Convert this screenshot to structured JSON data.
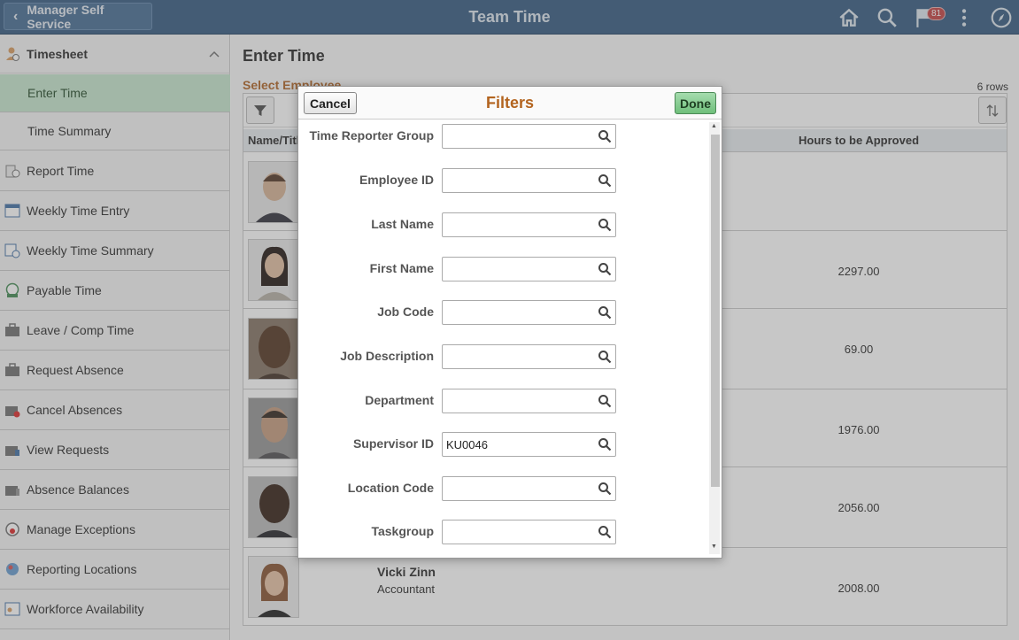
{
  "header": {
    "back_label": "Manager Self Service",
    "title": "Team Time",
    "notification_count": "81"
  },
  "sidebar": {
    "group": "Timesheet",
    "subitems": [
      "Enter Time",
      "Time Summary"
    ],
    "items": [
      "Report Time",
      "Weekly Time Entry",
      "Weekly Time Summary",
      "Payable Time",
      "Leave / Comp Time",
      "Request Absence",
      "Cancel Absences",
      "View Requests",
      "Absence Balances",
      "Manage Exceptions",
      "Reporting Locations",
      "Workforce Availability"
    ]
  },
  "main": {
    "title": "Enter Time",
    "section": "Select Employee",
    "row_count": "6 rows",
    "columns": {
      "name": "Name/Title",
      "hours": "Hours to be Approved"
    },
    "rows": [
      {
        "hours": "",
        "name": "",
        "title": ""
      },
      {
        "hours": "2297.00",
        "name": "",
        "title": ""
      },
      {
        "hours": "69.00",
        "name": "",
        "title": ""
      },
      {
        "hours": "1976.00",
        "name": "",
        "title": ""
      },
      {
        "hours": "2056.00",
        "name": "",
        "title": ""
      },
      {
        "hours": "2008.00",
        "name": "Vicki Zinn",
        "title": "Accountant"
      }
    ]
  },
  "modal": {
    "title": "Filters",
    "cancel_label": "Cancel",
    "done_label": "Done",
    "fields": [
      {
        "label": "Time Reporter Group",
        "value": ""
      },
      {
        "label": "Employee ID",
        "value": ""
      },
      {
        "label": "Last Name",
        "value": ""
      },
      {
        "label": "First Name",
        "value": ""
      },
      {
        "label": "Job Code",
        "value": ""
      },
      {
        "label": "Job Description",
        "value": ""
      },
      {
        "label": "Department",
        "value": ""
      },
      {
        "label": "Supervisor ID",
        "value": "KU0046"
      },
      {
        "label": "Location Code",
        "value": ""
      },
      {
        "label": "Taskgroup",
        "value": ""
      }
    ]
  },
  "colors": {
    "header_bg": "#3e6287",
    "accent_orange": "#b3641f",
    "active_item_bg": "#c9e7d0",
    "done_green": "#6fbf7b"
  }
}
